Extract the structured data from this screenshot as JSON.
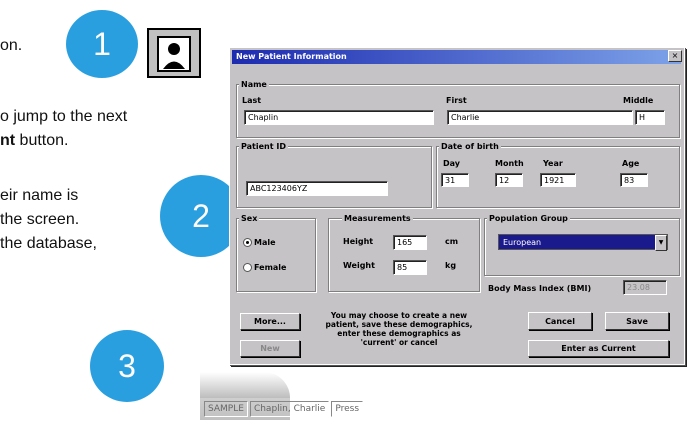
{
  "instructions": {
    "line1": "on.",
    "line2a": "o jump to the next",
    "line2b_bold": "nt",
    "line2b_rest": " button.",
    "line3": "eir name is",
    "line4": "the screen.",
    "line5": "the database,"
  },
  "badges": {
    "one": "1",
    "two": "2",
    "three": "3"
  },
  "dialog": {
    "title": "New Patient Information",
    "close": "×",
    "name_group": "Name",
    "last_label": "Last",
    "last_value": "Chaplin",
    "first_label": "First",
    "first_value": "Charlie",
    "middle_label": "Middle",
    "middle_value": "H",
    "patient_id_label": "Patient ID",
    "patient_id_value": "ABC123406YZ",
    "dob_label": "Date of birth",
    "day_label": "Day",
    "day_value": "31",
    "month_label": "Month",
    "month_value": "12",
    "year_label": "Year",
    "year_value": "1921",
    "age_label": "Age",
    "age_value": "83",
    "sex_label": "Sex",
    "male_label": "Male",
    "female_label": "Female",
    "measurements_label": "Measurements",
    "height_label": "Height",
    "height_value": "165",
    "height_unit": "cm",
    "weight_label": "Weight",
    "weight_value": "85",
    "weight_unit": "kg",
    "population_label": "Population Group",
    "population_value": "European",
    "bmi_label": "Body Mass Index (BMI)",
    "bmi_value": "23.08",
    "more_button": "More...",
    "new_button": "New",
    "message": "You may choose to create a new patient, save these demographics, enter these demographics as 'current' or cancel",
    "cancel_button": "Cancel",
    "save_button": "Save",
    "enter_current_button": "Enter as Current"
  },
  "statusbar": {
    "cell1": "SAMPLE",
    "cell2": "Chaplin, Charlie",
    "cell3": "Press"
  }
}
